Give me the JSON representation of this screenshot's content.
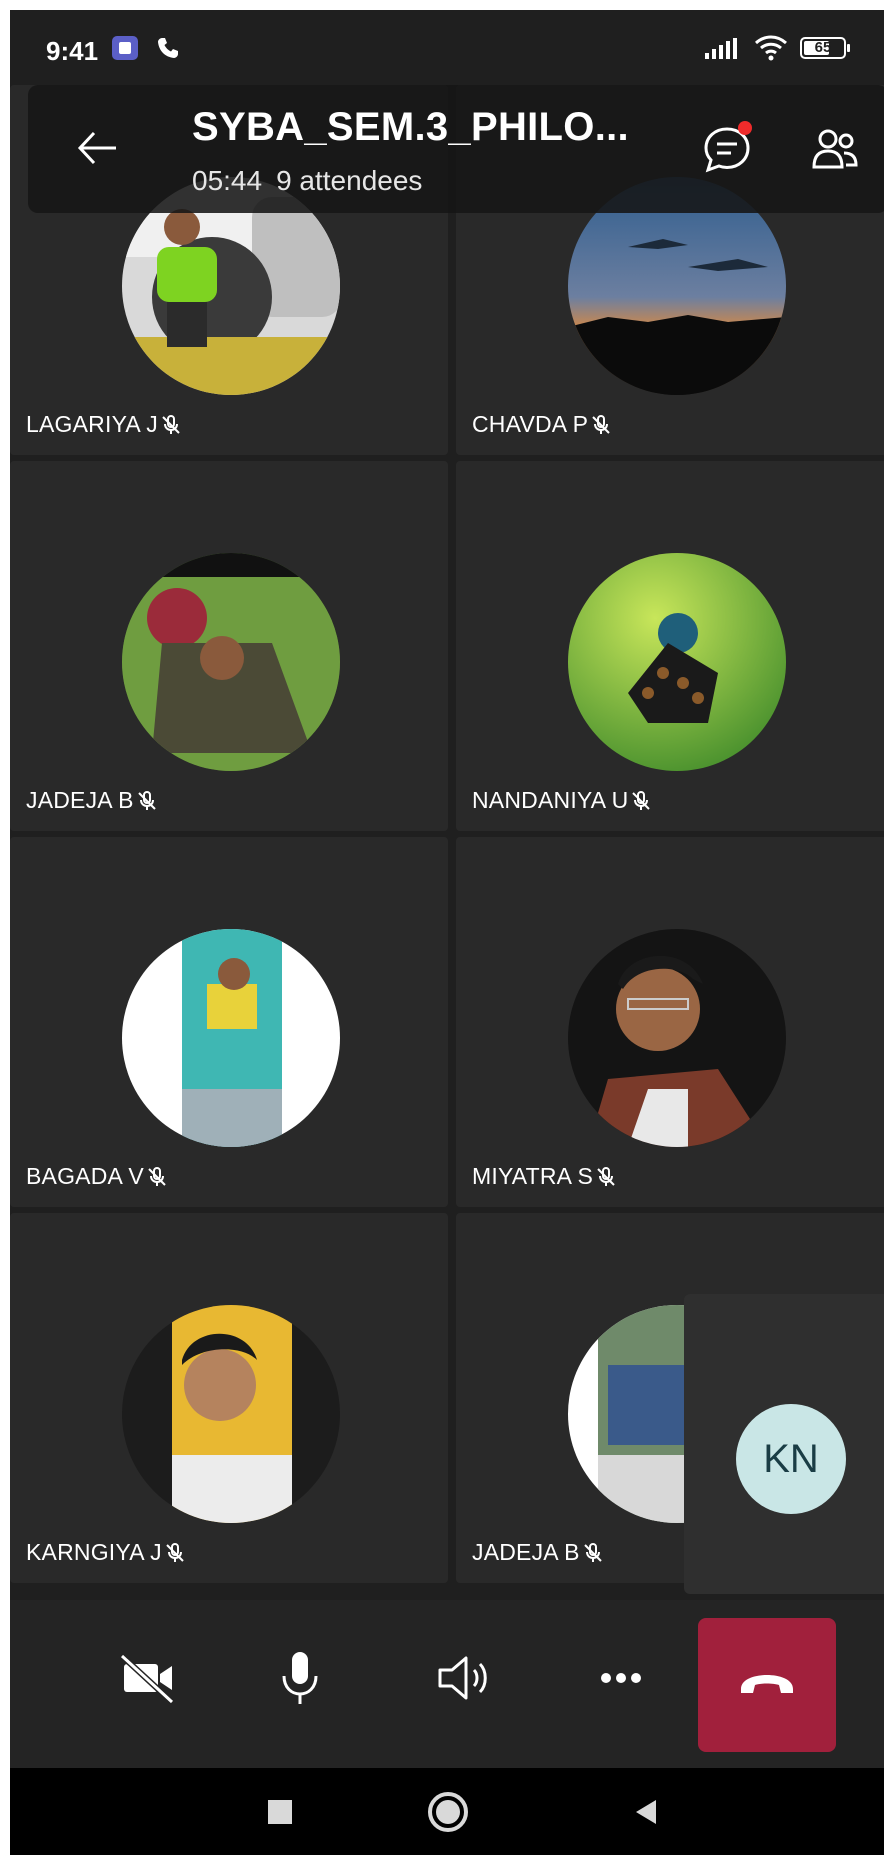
{
  "status_bar": {
    "time": "9:41",
    "battery": "65",
    "battery_level_percent": 65,
    "icons": [
      "teams-notification-icon",
      "phone-call-icon",
      "signal-icon",
      "wifi-icon",
      "battery-icon"
    ]
  },
  "header": {
    "title": "SYBA_SEM.3_PHILO...",
    "duration": "05:44",
    "attendees": "9 attendees",
    "chat_unread_dot_color": "#ef2b2b"
  },
  "participants": [
    {
      "name": "LAGARIYA J",
      "muted": true
    },
    {
      "name": "CHAVDA P",
      "muted": true
    },
    {
      "name": "JADEJA B",
      "muted": true
    },
    {
      "name": "NANDANIYA U",
      "muted": true
    },
    {
      "name": "BAGADA V",
      "muted": true
    },
    {
      "name": "MIYATRA S",
      "muted": true
    },
    {
      "name": "KARNGIYA J",
      "muted": true
    },
    {
      "name": "JADEJA B",
      "muted": true
    }
  ],
  "self_view": {
    "initials": "KN"
  },
  "controls": {
    "icons": [
      "video-off-icon",
      "microphone-icon",
      "speaker-icon",
      "more-options-icon",
      "hang-up-icon"
    ],
    "hangup_color": "#a1203c"
  },
  "nav": {
    "icons": [
      "recents-square-icon",
      "home-circle-icon",
      "back-triangle-icon"
    ]
  }
}
